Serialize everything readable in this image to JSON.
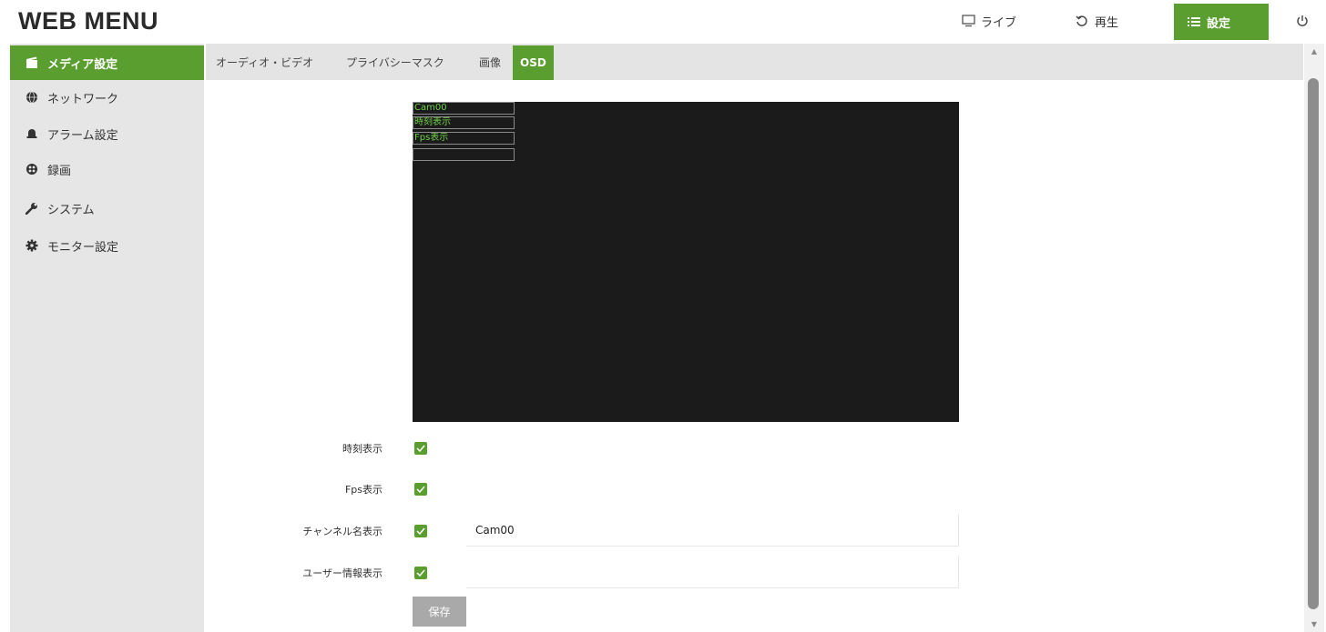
{
  "app": {
    "title": "WEB MENU"
  },
  "topnav": {
    "live": {
      "label": "ライブ",
      "icon": "monitor-icon"
    },
    "playback": {
      "label": "再生",
      "icon": "replay-icon"
    },
    "settings": {
      "label": "設定",
      "icon": "list-icon"
    },
    "power": {
      "icon": "power-icon"
    }
  },
  "sidebar": {
    "items": [
      {
        "label": "メディア設定",
        "icon": "media-icon",
        "active": true
      },
      {
        "label": "ネットワーク",
        "icon": "globe-icon",
        "active": false
      },
      {
        "label": "アラーム設定",
        "icon": "alarm-icon",
        "active": false
      },
      {
        "label": "録画",
        "icon": "record-icon",
        "active": false
      },
      {
        "label": "システム",
        "icon": "wrench-icon",
        "active": false
      },
      {
        "label": "モニター設定",
        "icon": "gear-icon",
        "active": false
      }
    ]
  },
  "tabs": [
    {
      "label": "オーディオ・ビデオ",
      "active": false
    },
    {
      "label": "プライバシーマスク",
      "active": false
    },
    {
      "label": "画像",
      "active": false
    },
    {
      "label": "OSD",
      "active": true
    }
  ],
  "preview": {
    "osd_lines": [
      "Cam00",
      "時刻表示",
      "Fps表示",
      ""
    ]
  },
  "form": {
    "time_display": {
      "label": "時刻表示",
      "checked": true
    },
    "fps_display": {
      "label": "Fps表示",
      "checked": true
    },
    "channel_name": {
      "label": "チャンネル名表示",
      "checked": true,
      "value": "Cam00"
    },
    "user_info": {
      "label": "ユーザー情報表示",
      "checked": true,
      "value": ""
    },
    "save_label": "保存"
  },
  "colors": {
    "accent": "#5a9e2f",
    "sidebar_bg": "#e6e6e6",
    "tabbar_bg": "#e4e4e4",
    "preview_bg": "#1b1b1b",
    "osd_text": "#6fd14a",
    "save_button": "#a9a9a9"
  }
}
